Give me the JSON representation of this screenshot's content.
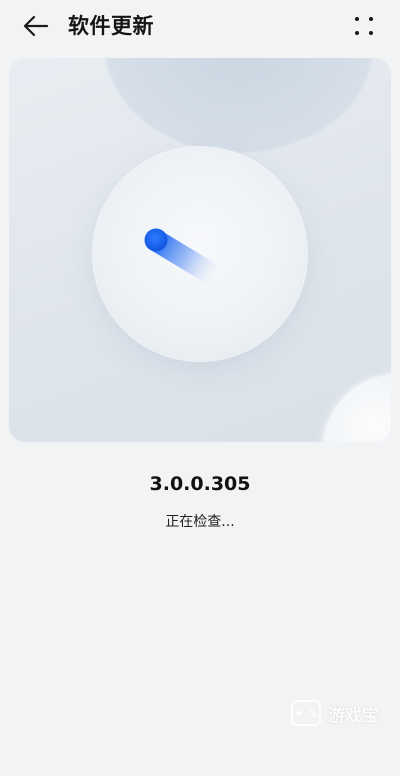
{
  "header": {
    "title": "软件更新",
    "back_icon": "arrow-left-icon",
    "more_icon": "four-dots-icon"
  },
  "hero": {
    "accent_color": "#1565f0"
  },
  "update": {
    "version": "3.0.0.305",
    "status": "正在检查..."
  },
  "watermark": {
    "text": "游戏宝"
  }
}
